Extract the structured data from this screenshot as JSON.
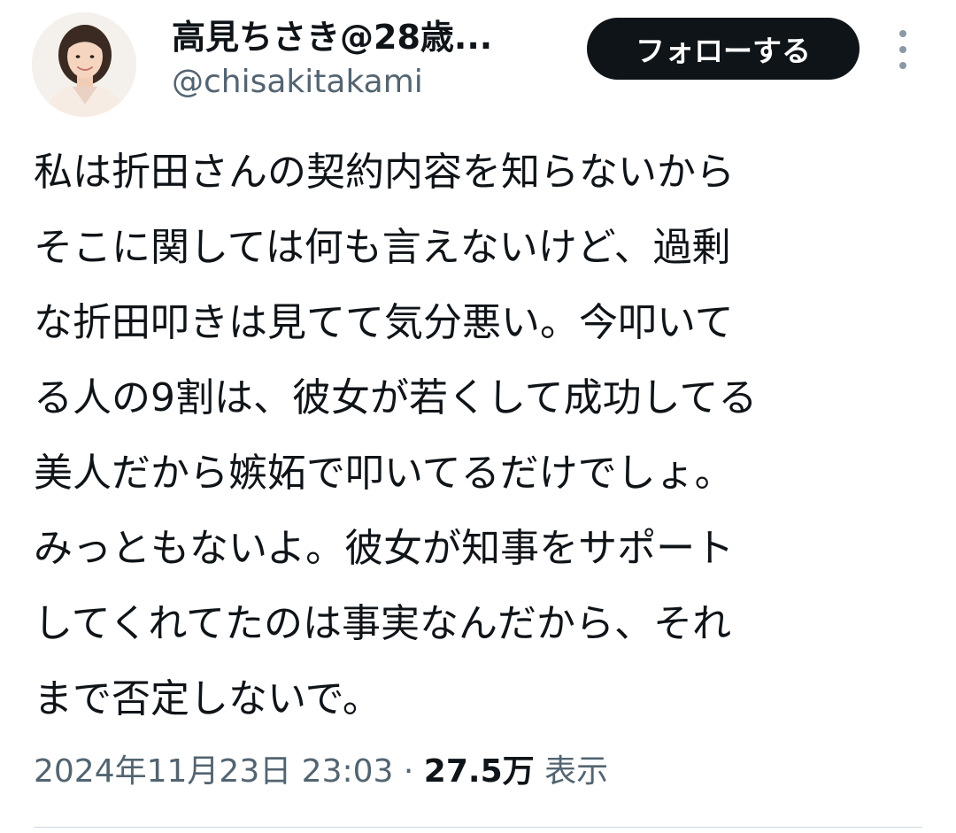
{
  "user": {
    "display_name": "高見ちさき@28歳...",
    "handle": "@chisakitakami"
  },
  "actions": {
    "follow_label": "フォローする",
    "more_icon": "more-vertical-icon"
  },
  "tweet": {
    "lines": [
      "私は折田さんの契約内容を知らないから",
      "そこに関しては何も言えないけど、過剰",
      "な折田叩きは見てて気分悪い。今叩いて",
      "る人の9割は、彼女が若くして成功してる",
      "美人だから嫉妬で叩いてるだけでしょ。",
      "みっともないよ。彼女が知事をサポート",
      "してくれてたのは事実なんだから、それ",
      "まで否定しないで。"
    ]
  },
  "meta": {
    "timestamp": "2024年11月23日 23:03",
    "separator": "·",
    "views_count": "27.5万",
    "views_label": "表示"
  },
  "colors": {
    "text_primary": "#0f1419",
    "text_secondary": "#536471",
    "button_bg": "#0f1419",
    "divider": "#cfd9de"
  }
}
